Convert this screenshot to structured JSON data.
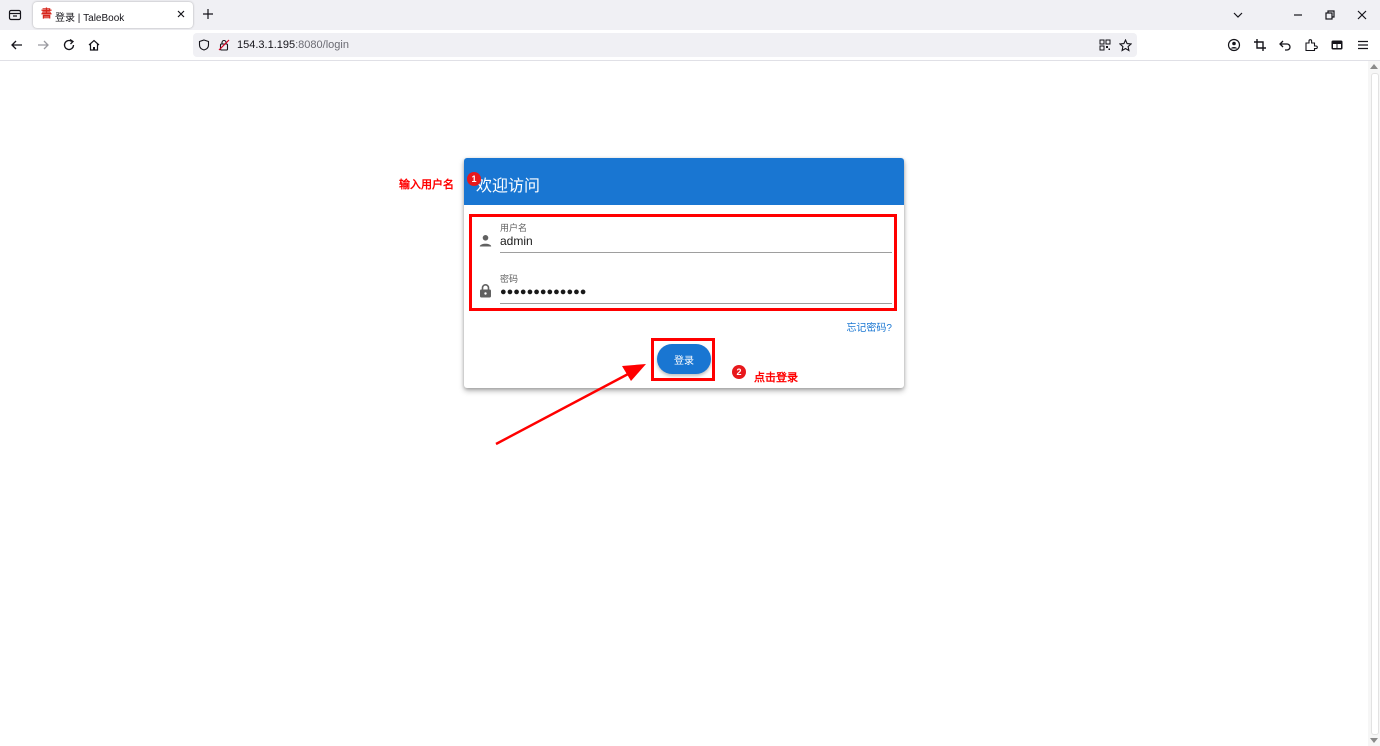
{
  "browser": {
    "tab_title": "登录 | TaleBook",
    "tab_favicon": "書",
    "url_host": "154.3.1.195",
    "url_rest": ":8080/login"
  },
  "login": {
    "title": "欢迎访问",
    "username_label": "用户名",
    "username_value": "admin",
    "password_label": "密码",
    "password_value": "●●●●●●●●●●●●●",
    "forgot_label": "忘记密码?",
    "submit_label": "登录"
  },
  "annotations": {
    "step1_badge": "1",
    "step1_text": "输入用户名",
    "step2_badge": "2",
    "step2_text": "点击登录"
  },
  "colors": {
    "primary": "#1976d2",
    "annotation": "#ff0000"
  },
  "icons": {
    "username": "person-icon",
    "password": "lock-icon"
  }
}
